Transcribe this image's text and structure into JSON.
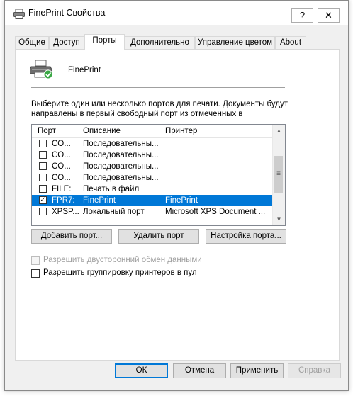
{
  "window": {
    "title": "FinePrint Свойства",
    "help_label": "?",
    "close_label": "✕"
  },
  "tabs": [
    {
      "label": "Общие"
    },
    {
      "label": "Доступ"
    },
    {
      "label": "Порты",
      "active": true
    },
    {
      "label": "Дополнительно"
    },
    {
      "label": "Управление цветом"
    },
    {
      "label": "About"
    }
  ],
  "printer": {
    "name": "FinePrint"
  },
  "description": "Выберите один или несколько портов для печати. Документы будут направлены в первый свободный порт из отмеченных в",
  "ports_list": {
    "columns": [
      "Порт",
      "Описание",
      "Принтер"
    ],
    "rows": [
      {
        "checked": false,
        "port": "CO...",
        "desc": "Последовательны...",
        "printer": ""
      },
      {
        "checked": false,
        "port": "CO...",
        "desc": "Последовательны...",
        "printer": ""
      },
      {
        "checked": false,
        "port": "CO...",
        "desc": "Последовательны...",
        "printer": ""
      },
      {
        "checked": false,
        "port": "CO...",
        "desc": "Последовательны...",
        "printer": ""
      },
      {
        "checked": false,
        "port": "FILE:",
        "desc": "Печать в файл",
        "printer": ""
      },
      {
        "checked": true,
        "port": "FPR7:",
        "desc": "FinePrint",
        "printer": "FinePrint",
        "selected": true
      },
      {
        "checked": false,
        "port": "XPSP...",
        "desc": "Локальный порт",
        "printer": "Microsoft XPS Document ..."
      }
    ]
  },
  "port_buttons": {
    "add": "Добавить порт...",
    "delete": "Удалить порт",
    "configure": "Настройка порта..."
  },
  "options": {
    "bidirectional": "Разрешить двусторонний обмен данными",
    "pooling": "Разрешить группировку принтеров в пул"
  },
  "dialog_buttons": {
    "ok": "ОК",
    "cancel": "Отмена",
    "apply": "Применить",
    "help": "Справка"
  }
}
